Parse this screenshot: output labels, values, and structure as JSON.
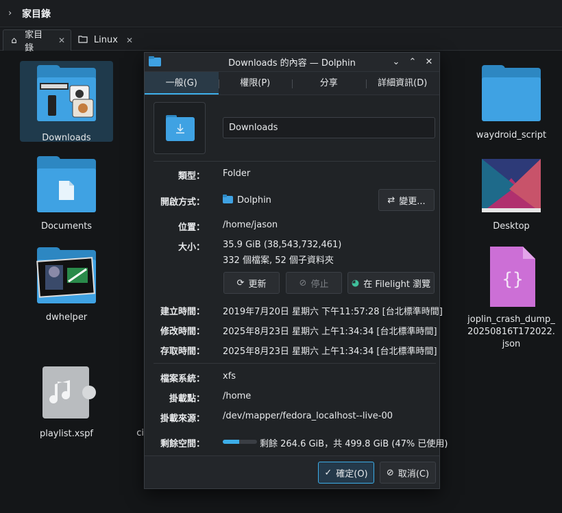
{
  "breadcrumb": {
    "label": "家目錄"
  },
  "tabs": [
    {
      "label": "家目錄",
      "icon": "home-icon"
    },
    {
      "label": "Linux",
      "icon": "folder-icon"
    }
  ],
  "files": [
    {
      "name": "Downloads"
    },
    {
      "name": "Documents"
    },
    {
      "name": "dwhelper"
    },
    {
      "name": "playlist.xspf"
    },
    {
      "name": "ci"
    },
    {
      "name": "waydroid_script"
    },
    {
      "name": "Desktop"
    },
    {
      "name": "joplin_crash_dump_20250816T172022.json",
      "lines": [
        "joplin_crash_dump_",
        "20250816T172022.",
        "json"
      ]
    }
  ],
  "dialog": {
    "title": "Downloads 的內容 — Dolphin",
    "tabs": [
      "一般(G)",
      "權限(P)",
      "分享",
      "詳細資訊(D)"
    ],
    "name_value": "Downloads",
    "rows": {
      "type_label": "類型：",
      "type_value": "Folder",
      "open_label": "開啟方式：",
      "open_value": "Dolphin",
      "change_button": "變更...",
      "location_label": "位置：",
      "location_value": "/home/jason",
      "size_label": "大小：",
      "size_value": "35.9 GiB (38,543,732,461)",
      "size_counts": "332 個檔案, 52 個子資料夾",
      "refresh_button": "更新",
      "stop_button": "停止",
      "filelight_button": "在 Filelight 瀏覽",
      "created_label": "建立時間：",
      "created_value": "2019年7月20日 星期六 下午11:57:28 [台北標準時間]",
      "modified_label": "修改時間：",
      "modified_value": "2025年8月23日 星期六 上午1:34:34 [台北標準時間]",
      "accessed_label": "存取時間：",
      "accessed_value": "2025年8月23日 星期六 上午1:34:34 [台北標準時間]",
      "fs_label": "檔案系統：",
      "fs_value": "xfs",
      "mount_label": "掛載點：",
      "mount_value": "/home",
      "mount_src_label": "掛載來源：",
      "mount_src_value": "/dev/mapper/fedora_localhost--live-00",
      "free_label": "剩餘空間：",
      "free_value": "剩餘 264.6 GiB，共 499.8 GiB (47% 已使用)",
      "used_fraction": 0.47
    },
    "ok_button": "確定(O)",
    "cancel_button": "取消(C)"
  },
  "colors": {
    "accent": "#3daee9",
    "folder": "#3fa2e3",
    "background": "#141618"
  }
}
